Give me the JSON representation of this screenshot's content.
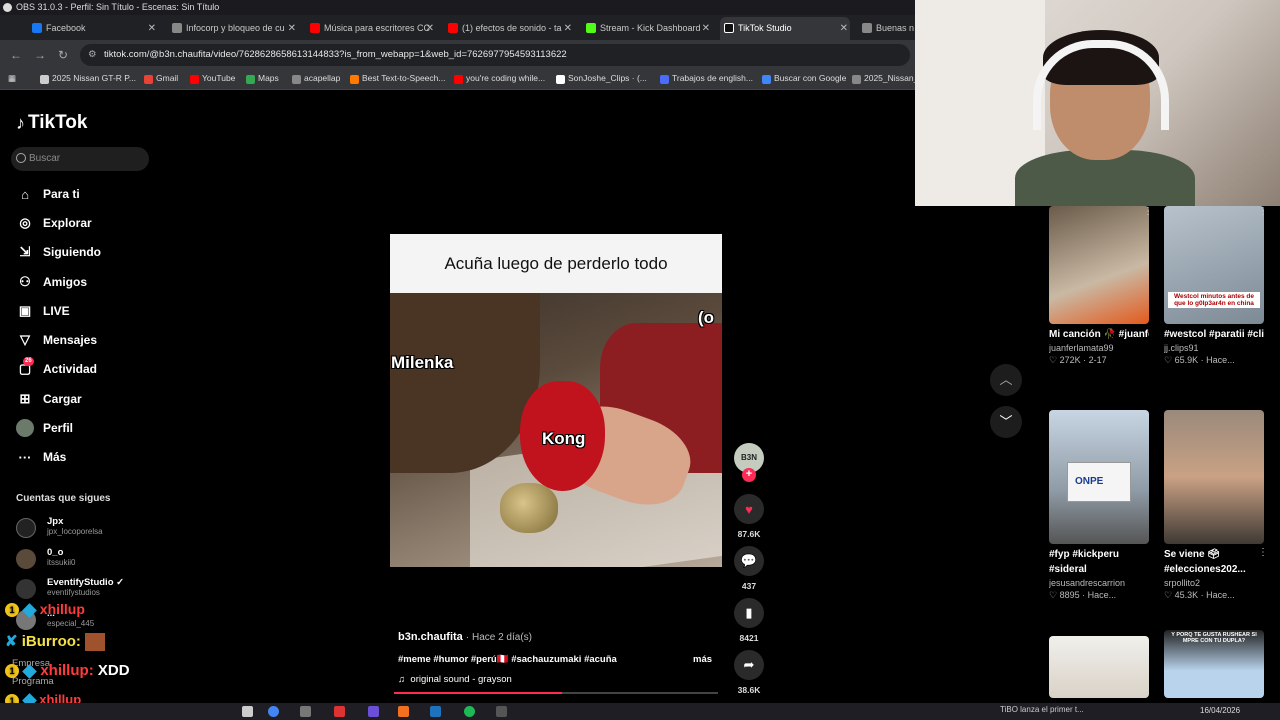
{
  "obs": {
    "title": "OBS 31.0.3 - Perfil: Sin Título - Escenas: Sin Título"
  },
  "browser": {
    "tabs": [
      {
        "label": "Facebook",
        "color": "#1877f2"
      },
      {
        "label": "Infocorp y bloqueo de cu",
        "color": "#888888"
      },
      {
        "label": "Música para escritores CC",
        "color": "#ff0000"
      },
      {
        "label": "(1) efectos de sonido - ta",
        "color": "#ff0000"
      },
      {
        "label": "Stream - Kick Dashboard",
        "color": "#53fc18"
      },
      {
        "label": "TikTok Studio",
        "color": "#111111"
      },
      {
        "label": "Buenas n",
        "color": "#888888"
      }
    ],
    "url": "tiktok.com/@b3n.chaufita/video/7628628658613144833?is_from_webapp=1&web_id=7626977954593113622",
    "bookmarks": [
      {
        "label": "2025 Nissan GT-R P...",
        "color": "#cccccc"
      },
      {
        "label": "Gmail",
        "color": "#ea4335"
      },
      {
        "label": "YouTube",
        "color": "#ff0000"
      },
      {
        "label": "Maps",
        "color": "#34a853"
      },
      {
        "label": "acapellap",
        "color": "#888888"
      },
      {
        "label": "Best Text-to-Speech...",
        "color": "#ff7a00"
      },
      {
        "label": "you're coding while...",
        "color": "#ff0000"
      },
      {
        "label": "SonJoshe_Clips · (...",
        "color": "#ffffff"
      },
      {
        "label": "Trabajos de english...",
        "color": "#4a6cf7"
      },
      {
        "label": "Buscar con Google",
        "color": "#4285f4"
      },
      {
        "label": "2025_Nissan_",
        "color": "#888888"
      }
    ]
  },
  "sidebar": {
    "brand": "TikTok",
    "search_placeholder": "Buscar",
    "nav": [
      {
        "label": "Para ti",
        "icon": "home-icon"
      },
      {
        "label": "Explorar",
        "icon": "compass-icon"
      },
      {
        "label": "Siguiendo",
        "icon": "following-icon"
      },
      {
        "label": "Amigos",
        "icon": "friends-icon"
      },
      {
        "label": "LIVE",
        "icon": "live-icon"
      },
      {
        "label": "Mensajes",
        "icon": "messages-icon"
      },
      {
        "label": "Actividad",
        "icon": "activity-icon",
        "badge": "26"
      },
      {
        "label": "Cargar",
        "icon": "upload-icon"
      },
      {
        "label": "Perfil",
        "icon": "profile-avatar"
      },
      {
        "label": "Más",
        "icon": "more-icon"
      }
    ],
    "following_title": "Cuentas que sigues",
    "accounts": [
      {
        "name": "Jpx",
        "handle": "jpx_locoporelsa"
      },
      {
        "name": "0_o",
        "handle": "itssukii0"
      },
      {
        "name": "EventifyStudio ✓",
        "handle": "eventifystudios"
      },
      {
        "name": "...",
        "handle": "especial_445"
      },
      {
        "name": "Empresa",
        "handle": ""
      },
      {
        "name": "Programa",
        "handle": ""
      }
    ]
  },
  "chat": [
    {
      "user": "xhillup",
      "message": "",
      "color": "#ff3b3b"
    },
    {
      "user": "iBurroo",
      "message": "",
      "color": "#f5e04a"
    },
    {
      "user": "xhillup",
      "message": "XDD",
      "color": "#ff3b3b"
    },
    {
      "user": "xhillup",
      "message": "",
      "color": "#ff3b3b"
    }
  ],
  "video": {
    "caption": "Acuña luego de perderlo todo",
    "label_left": "Milenka",
    "label_center": "Kong",
    "label_corner": "(o",
    "author": "b3n.chaufita",
    "posted": "· Hace 2 día(s)",
    "tags": "#meme #humor #perú🇵🇪 #sachauzumaki #acuña",
    "more": "más",
    "sound": "original sound - grayson",
    "progress": 0.52
  },
  "actions": {
    "creator_initials": "B3N",
    "likes": "87.6K",
    "comments": "437",
    "saves": "8421",
    "shares": "38.6K"
  },
  "recommended": [
    {
      "title": "Mi canción 🥀 #juanferlamata",
      "author": "juanferlamata99",
      "likes": "272K",
      "when": "2-17",
      "overlay": ""
    },
    {
      "title": "#westcol #paratii #clips #kick...",
      "author": "jj.clips91",
      "likes": "65.9K",
      "when": "Hace...",
      "overlay": "Westcol minutos antes de que lo g0lp3ar4n en china"
    },
    {
      "title": "#fyp #kickperu #sideral",
      "author": "jesusandrescarrion",
      "likes": "8895",
      "when": "Hace...",
      "overlay": ""
    },
    {
      "title": "Se viene 🗳 #elecciones202...",
      "author": "srpollito2",
      "likes": "45.3K",
      "when": "Hace...",
      "overlay": ""
    },
    {
      "title": "",
      "author": "",
      "likes": "",
      "when": "",
      "overlay": ""
    },
    {
      "title": "",
      "author": "",
      "likes": "",
      "when": "",
      "overlay": "Y PORQ TE GUSTA RUSHEAR SI MPRE CON TU DUPLA?"
    }
  ],
  "truck_text": "ONPE",
  "taskbar": {
    "news": "TiBO lanza el primer t...",
    "date": "16/04/2026"
  }
}
